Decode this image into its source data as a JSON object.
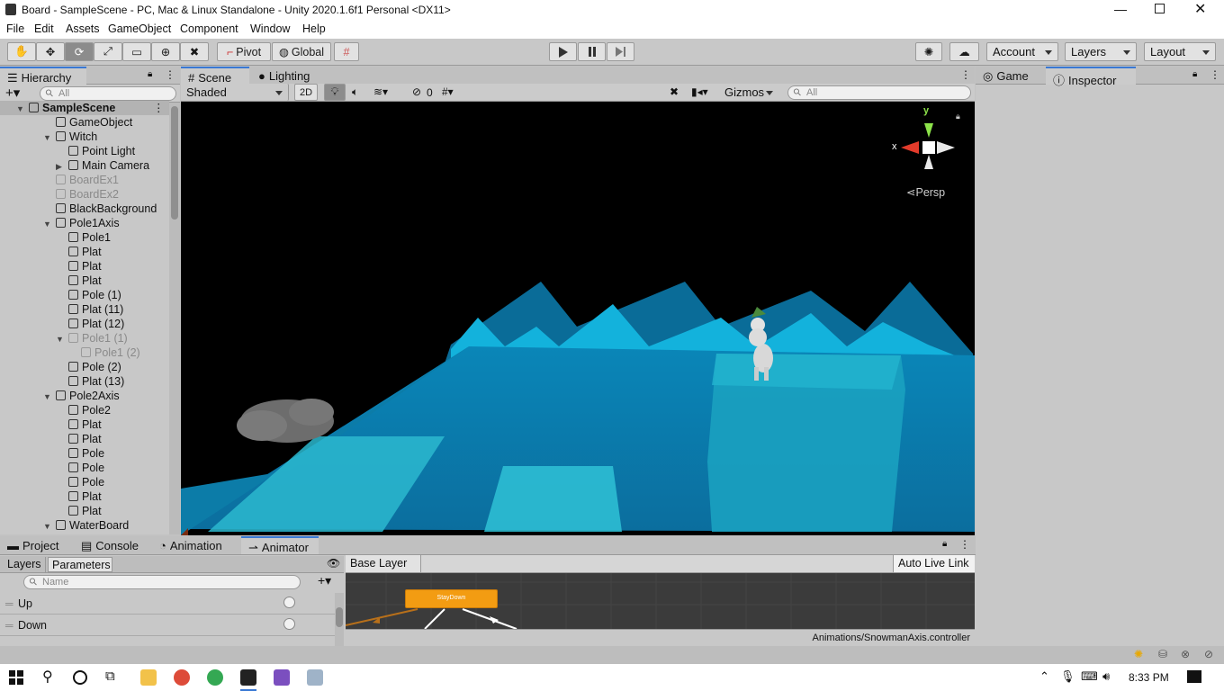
{
  "window": {
    "title": "Board - SampleScene - PC, Mac & Linux Standalone - Unity 2020.1.6f1 Personal <DX11>"
  },
  "menu": [
    "File",
    "Edit",
    "Assets",
    "GameObject",
    "Component",
    "Window",
    "Help"
  ],
  "toolbar": {
    "pivot": "Pivot",
    "global": "Global",
    "account": "Account",
    "layers": "Layers",
    "layout": "Layout"
  },
  "hierarchy": {
    "tab": "Hierarchy",
    "search_placeholder": "All",
    "rows": [
      {
        "label": "SampleScene",
        "indent": 0
      },
      {
        "label": "GameObject",
        "indent": 1
      },
      {
        "label": "Witch",
        "indent": 1
      },
      {
        "label": "Point Light",
        "indent": 2
      },
      {
        "label": "Main Camera",
        "indent": 2
      },
      {
        "label": "BoardEx1",
        "indent": 1
      },
      {
        "label": "BoardEx2",
        "indent": 1
      },
      {
        "label": "BlackBackground",
        "indent": 1
      },
      {
        "label": "Pole1Axis",
        "indent": 1
      },
      {
        "label": "Pole1",
        "indent": 2
      },
      {
        "label": "Plat",
        "indent": 2
      },
      {
        "label": "Plat",
        "indent": 2
      },
      {
        "label": "Plat",
        "indent": 2
      },
      {
        "label": "Pole (1)",
        "indent": 2
      },
      {
        "label": "Plat (11)",
        "indent": 2
      },
      {
        "label": "Plat (12)",
        "indent": 2
      },
      {
        "label": "Pole1 (1)",
        "indent": 2
      },
      {
        "label": "Pole1 (2)",
        "indent": 3
      },
      {
        "label": "Pole (2)",
        "indent": 2
      },
      {
        "label": "Plat (13)",
        "indent": 2
      },
      {
        "label": "Pole2Axis",
        "indent": 1
      },
      {
        "label": "Pole2",
        "indent": 2
      },
      {
        "label": "Plat",
        "indent": 2
      },
      {
        "label": "Plat",
        "indent": 2
      },
      {
        "label": "Pole",
        "indent": 2
      },
      {
        "label": "Pole",
        "indent": 2
      },
      {
        "label": "Pole",
        "indent": 2
      },
      {
        "label": "Plat",
        "indent": 2
      },
      {
        "label": "Plat",
        "indent": 2
      },
      {
        "label": "WaterBoard",
        "indent": 1
      }
    ]
  },
  "scene": {
    "tabs": [
      "Scene",
      "Lighting"
    ],
    "shading": "Shaded",
    "mode_2d": "2D",
    "hidden_count": "0",
    "gizmos": "Gizmos",
    "search_placeholder": "All",
    "gizmo_x": "x",
    "gizmo_y": "y",
    "persp": "Persp"
  },
  "right": {
    "tabs": [
      "Game",
      "Inspector"
    ]
  },
  "bottom": {
    "tabs": [
      "Project",
      "Console",
      "Animation",
      "Animator"
    ],
    "sub_tabs": [
      "Layers",
      "Parameters"
    ],
    "param_search": "Name",
    "params": [
      {
        "name": "Up"
      },
      {
        "name": "Down"
      }
    ],
    "breadcrumb": "Base Layer",
    "auto_live_link": "Auto Live Link",
    "state_node": "StayDown",
    "controller_path": "Animations/SnowmanAxis.controller"
  },
  "taskbar": {
    "time": "8:33 PM"
  }
}
